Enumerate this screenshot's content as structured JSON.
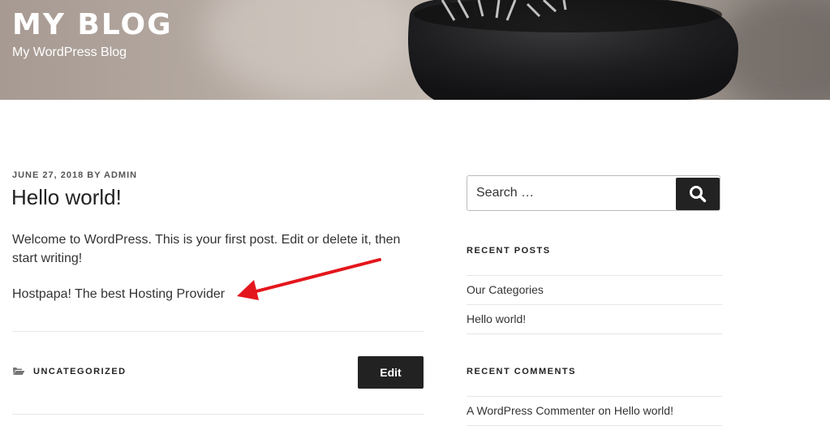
{
  "header": {
    "site_title": "MY BLOG",
    "site_description": "My WordPress Blog"
  },
  "post": {
    "date": "JUNE 27, 2018",
    "by": "BY",
    "author": "ADMIN",
    "title": "Hello world!",
    "paragraphs": [
      "Welcome to WordPress. This is your first post. Edit or delete it, then start writing!",
      "Hostpapa! The best Hosting Provider"
    ],
    "category": "UNCATEGORIZED",
    "edit_label": "Edit"
  },
  "sidebar": {
    "search": {
      "placeholder": "Search …"
    },
    "recent_posts": {
      "title": "RECENT POSTS",
      "items": [
        "Our Categories",
        "Hello world!"
      ]
    },
    "recent_comments": {
      "title": "RECENT COMMENTS",
      "comment": {
        "author": "A WordPress Commenter",
        "on": "on",
        "post": "Hello world!"
      }
    }
  },
  "icons": {
    "search": "search-icon",
    "category": "folder-icon",
    "annotation": "red-arrow-icon"
  },
  "colors": {
    "annotation_arrow": "#e4161c",
    "button_bg": "#222222",
    "button_text": "#ffffff",
    "divider": "#e6e6e6"
  }
}
